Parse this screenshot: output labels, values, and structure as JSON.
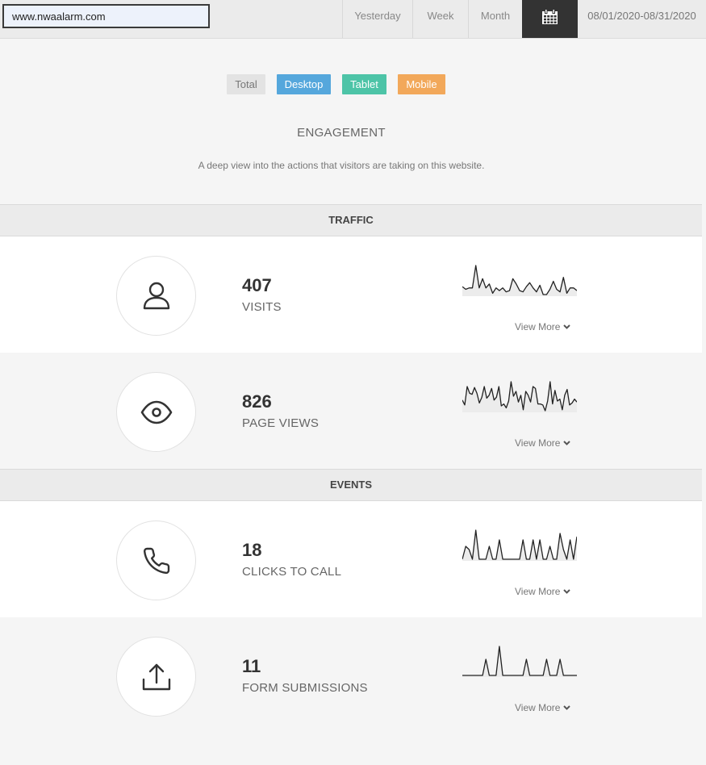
{
  "header": {
    "site_url": "www.nwaalarm.com",
    "ranges": [
      "Yesterday",
      "Week",
      "Month"
    ],
    "calendar_icon": "calendar-icon",
    "date_range": "08/01/2020-08/31/2020"
  },
  "filters": {
    "total": "Total",
    "desktop": "Desktop",
    "tablet": "Tablet",
    "mobile": "Mobile",
    "colors": {
      "desktop": "#55a7dc",
      "tablet": "#4dc4a7",
      "mobile": "#f2a85a"
    }
  },
  "intro": {
    "title": "ENGAGEMENT",
    "subtitle": "A deep view into the actions that visitors are taking on this website."
  },
  "sections": {
    "traffic": "TRAFFIC",
    "events": "EVENTS"
  },
  "metrics": [
    {
      "value": "407",
      "label": "VISITS",
      "icon": "user-icon",
      "more": "View More",
      "spark": [
        10,
        8,
        9,
        9,
        26,
        9,
        16,
        9,
        12,
        5,
        9,
        7,
        9,
        6,
        7,
        16,
        12,
        7,
        6,
        10,
        13,
        9,
        6,
        11,
        4,
        4,
        8,
        14,
        8,
        6,
        17,
        5,
        9,
        9,
        7
      ]
    },
    {
      "value": "826",
      "label": "PAGE VIEWS",
      "icon": "eye-icon",
      "more": "View More",
      "spark": [
        15,
        10,
        29,
        22,
        21,
        28,
        22,
        12,
        18,
        29,
        17,
        20,
        27,
        15,
        18,
        29,
        9,
        11,
        7,
        14,
        34,
        19,
        24,
        13,
        20,
        5,
        24,
        20,
        13,
        29,
        27,
        11,
        11,
        10,
        4,
        14,
        34,
        11,
        25,
        14,
        16,
        5,
        20,
        26,
        10,
        12,
        16,
        13
      ]
    },
    {
      "value": "18",
      "label": "CLICKS TO CALL",
      "icon": "phone-icon",
      "more": "View More",
      "spark": [
        0,
        4,
        3,
        0,
        9,
        0,
        0,
        0,
        4,
        0,
        0,
        6,
        0,
        0,
        0,
        0,
        0,
        0,
        6,
        0,
        0,
        6,
        0,
        6,
        0,
        0,
        4,
        0,
        0,
        8,
        3,
        0,
        6,
        0,
        7
      ]
    },
    {
      "value": "11",
      "label": "FORM SUBMISSIONS",
      "icon": "upload-icon",
      "more": "View More",
      "spark": [
        0,
        0,
        0,
        0,
        0,
        0,
        0,
        5,
        0,
        0,
        0,
        9,
        0,
        0,
        0,
        0,
        0,
        0,
        0,
        5,
        0,
        0,
        0,
        0,
        0,
        5,
        0,
        0,
        0,
        5,
        0,
        0,
        0,
        0,
        0
      ]
    }
  ]
}
